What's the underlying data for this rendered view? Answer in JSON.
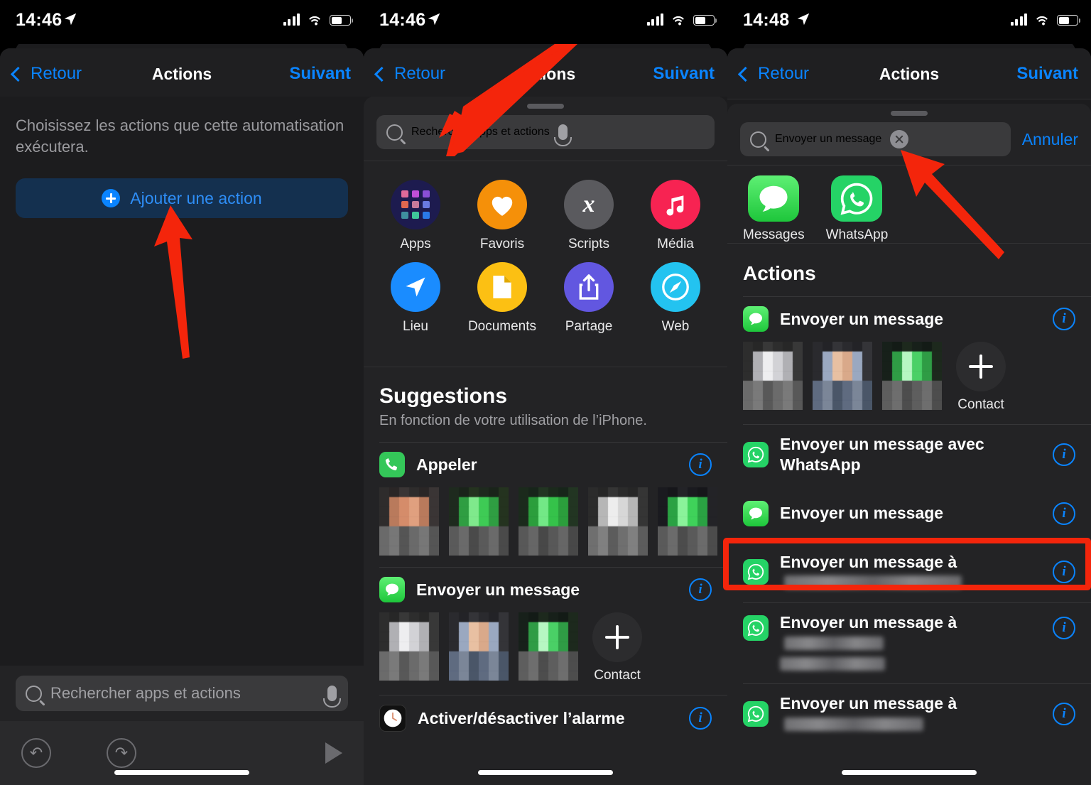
{
  "panels": [
    {
      "status": {
        "time": "14:46",
        "location_icon": "location-arrow-icon",
        "battery_icon": "battery-half-icon",
        "wifi_icon": "wifi-icon",
        "cellular_icon": "cellular-bars-icon"
      },
      "nav": {
        "back": "Retour",
        "title": "Actions",
        "next": "Suivant"
      },
      "hint": "Choisissez les actions que cette automatisation exécutera.",
      "add_action_button": "Ajouter une action",
      "search": {
        "placeholder": "Rechercher apps et actions",
        "mic_icon": "microphone-icon",
        "search_icon": "search-icon"
      },
      "toolbar": {
        "undo_icon": "undo-icon",
        "redo_icon": "redo-icon",
        "play_icon": "play-icon"
      }
    },
    {
      "status": {
        "time": "14:46"
      },
      "nav": {
        "back": "Retour",
        "title": "Actions",
        "next": "Suivant"
      },
      "search": {
        "placeholder": "Rechercher apps et actions"
      },
      "categories": [
        {
          "label": "Apps",
          "icon": "apps-grid-icon",
          "color": "#1d1b4f"
        },
        {
          "label": "Favoris",
          "icon": "heart-icon",
          "color": "#f59009"
        },
        {
          "label": "Scripts",
          "icon": "script-x-icon",
          "color": "#5a5a5e"
        },
        {
          "label": "Média",
          "icon": "music-note-icon",
          "color": "#f72352"
        },
        {
          "label": "Lieu",
          "icon": "navigation-arrow-icon",
          "color": "#1a8cff"
        },
        {
          "label": "Documents",
          "icon": "document-icon",
          "color": "#fcc013"
        },
        {
          "label": "Partage",
          "icon": "share-icon",
          "color": "#6257e0"
        },
        {
          "label": "Web",
          "icon": "safari-compass-icon",
          "color": "#23c3f0"
        }
      ],
      "suggestions": {
        "title": "Suggestions",
        "subtitle": "En fonction de votre utilisation de l’iPhone.",
        "items": [
          {
            "label": "Appeler",
            "icon": "phone-icon",
            "contacts": 5,
            "info_icon": "info-icon"
          },
          {
            "label": "Envoyer un message",
            "icon": "messages-icon",
            "contacts": 3,
            "add_contact_label": "Contact",
            "info_icon": "info-icon"
          },
          {
            "label": "Activer/désactiver l’alarme",
            "icon": "clock-icon",
            "info_icon": "info-icon"
          }
        ]
      }
    },
    {
      "status": {
        "time": "14:48"
      },
      "nav": {
        "back": "Retour",
        "title": "Actions",
        "next": "Suivant"
      },
      "search": {
        "value": "Envoyer un message",
        "cancel": "Annuler",
        "clear_icon": "clear-icon"
      },
      "apps": [
        {
          "label": "Messages",
          "icon": "messages-icon"
        },
        {
          "label": "WhatsApp",
          "icon": "whatsapp-icon"
        }
      ],
      "actions_title": "Actions",
      "actions": [
        {
          "label": "Envoyer un message",
          "icon": "messages-icon",
          "has_contacts": true,
          "add_contact_label": "Contact",
          "info_icon": "info-icon",
          "highlighted": false
        },
        {
          "label": "Envoyer un message avec WhatsApp",
          "icon": "whatsapp-icon",
          "info_icon": "info-icon",
          "highlighted": false
        },
        {
          "label": "Envoyer un message",
          "icon": "messages-icon",
          "info_icon": "info-icon",
          "highlighted": true
        },
        {
          "label": "Envoyer un message à",
          "redacted": "wide",
          "icon": "whatsapp-icon",
          "info_icon": "info-icon",
          "highlighted": false
        },
        {
          "label": "Envoyer un message à",
          "redacted": "twoline",
          "icon": "whatsapp-icon",
          "info_icon": "info-icon",
          "highlighted": false
        },
        {
          "label": "Envoyer un message à",
          "redacted": "medium",
          "icon": "whatsapp-icon",
          "info_icon": "info-icon",
          "highlighted": false
        }
      ]
    }
  ],
  "annotations": {
    "accent_color": "#f4250b",
    "arrows": [
      {
        "name": "arrow-to-add-action",
        "points_to": "Ajouter une action"
      },
      {
        "name": "arrow-to-search-field",
        "points_to": "Rechercher apps et actions"
      },
      {
        "name": "arrow-to-search-value",
        "points_to": "Envoyer un message"
      }
    ],
    "highlight_box": {
      "name": "highlight-send-message-action",
      "target": "Envoyer un message"
    }
  }
}
